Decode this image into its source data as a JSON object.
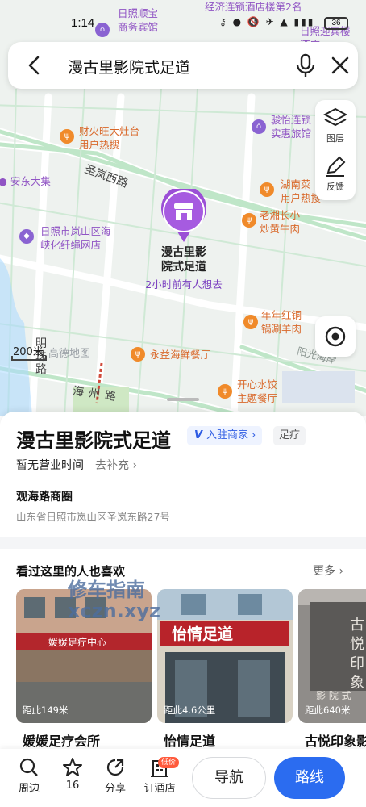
{
  "status": {
    "time": "1:14",
    "battery": "36"
  },
  "search": {
    "query": "漫古里影院式足道"
  },
  "side_tools": {
    "layers_label": "图层",
    "feedback_label": "反馈"
  },
  "map": {
    "roads": [
      {
        "name": "圣岚西路"
      },
      {
        "name": "明珠路"
      },
      {
        "name": "海州路"
      },
      {
        "name": "阳光海岸"
      }
    ],
    "pois": [
      {
        "name": "日照顺宝商务宾馆",
        "lines": [
          "日照顺宝",
          "商务宾馆"
        ]
      },
      {
        "name": "经济连锁酒店楼第2名"
      },
      {
        "name": "日照迎宾楼酒店",
        "lines": [
          "日照迎宾楼",
          "酒店"
        ]
      },
      {
        "name": "财火旺大灶台",
        "tag": "用户热搜"
      },
      {
        "name": "骏怡连锁酒店",
        "lines": [
          "骏怡连锁",
          "实惠旅馆"
        ]
      },
      {
        "name": "安东大集"
      },
      {
        "name": "湖南菜",
        "tag": "用户热搜"
      },
      {
        "name": "日照市岚山区海峡化纤绳网店",
        "lines": [
          "日照市岚山区海",
          "峡化纤绳网店"
        ]
      },
      {
        "name": "老湘长小炒黄牛肉",
        "lines": [
          "老湘长小",
          "炒黄牛肉"
        ]
      },
      {
        "name": "年年红铜锅涮羊肉",
        "lines": [
          "年年红铜",
          "锅涮羊肉"
        ]
      },
      {
        "name": "永益海鲜餐厅"
      },
      {
        "name": "开心水饺主题餐厅",
        "lines": [
          "开心水饺",
          "主题餐厅"
        ]
      }
    ],
    "marker": {
      "title_lines": [
        "漫古里影",
        "院式足道"
      ],
      "subtitle": "2小时前有人想去"
    },
    "scale": "200米",
    "watermark": "高德地图"
  },
  "place": {
    "name": "漫古里影院式足道",
    "merchant_badge": "入驻商家",
    "category": "足疗",
    "hours": "暂无营业时间",
    "hours_action": "去补充",
    "district": "观海路商圈",
    "address": "山东省日照市岚山区圣岚东路27号"
  },
  "recommend": {
    "title": "看过这里的人也喜欢",
    "more": "更多",
    "items": [
      {
        "name": "媛媛足疗会所",
        "distance": "距此149米",
        "sign": "媛媛足疗中心"
      },
      {
        "name": "怡情足道",
        "distance": "距此4.6公里",
        "sign": "怡情足道"
      },
      {
        "name": "古悦印象影",
        "distance": "距此640米",
        "sign": "古悦印象影院式"
      }
    ]
  },
  "site_watermark": {
    "cn": "修车指南",
    "url": "xczn.xyz"
  },
  "bottom": {
    "nearby": "周边",
    "favorites": "16",
    "share": "分享",
    "hotel": "订酒店",
    "hotel_badge": "低价",
    "navigate": "导航",
    "route": "路线"
  },
  "colors": {
    "accent_blue": "#2b6cf0",
    "marker_purple": "#9b4fd6",
    "poi_orange": "#d9682a"
  }
}
